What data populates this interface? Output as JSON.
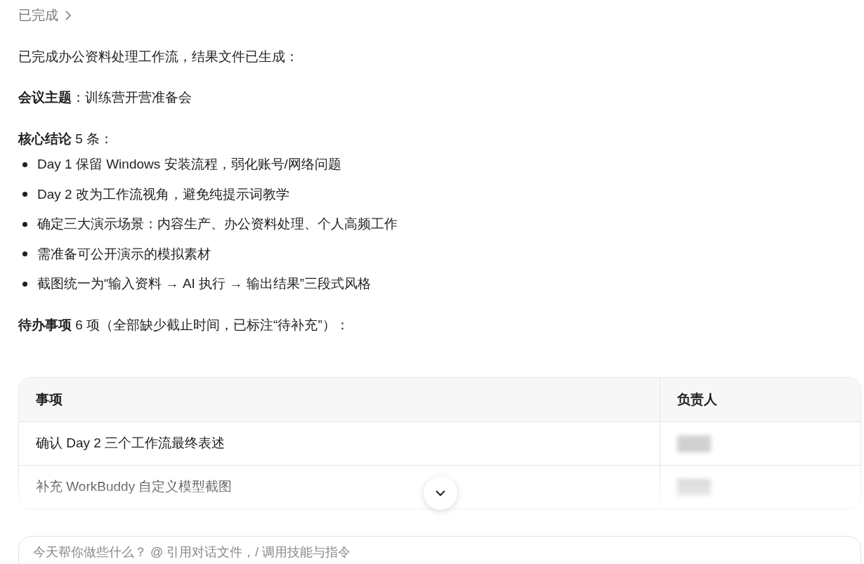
{
  "status_link": {
    "label": "已完成"
  },
  "intro": "已完成办公资料处理工作流，结果文件已生成：",
  "topic": "**会议主题**：训练营开营准备会",
  "conclusions_heading": "**核心结论** 5 条：",
  "conclusions": [
    "Day 1 保留 Windows 安装流程，弱化账号/网络问题",
    "Day 2 改为工作流视角，避免纯提示词教学",
    "确定三大演示场景：内容生产、办公资料处理、个人高频工作",
    "需准备可公开演示的模拟素材",
    "截图统一为“输入资料 → AI 执行 → 输出结果”三段式风格"
  ],
  "todos_heading": "**待办事项** 6 项（全部缺少截止时间，已标注“待补充”）：",
  "table": {
    "columns": [
      "事项",
      "负责人"
    ],
    "rows": [
      {
        "task": "确认 Day 2 三个工作流最终表述",
        "owner_redacted": true
      },
      {
        "task": "补充 WorkBuddy 自定义模型截图",
        "owner_redacted": true
      }
    ]
  },
  "composer": {
    "placeholder": "今天帮你做些什么？ @ 引用对话文件，/ 调用技能与指令"
  }
}
